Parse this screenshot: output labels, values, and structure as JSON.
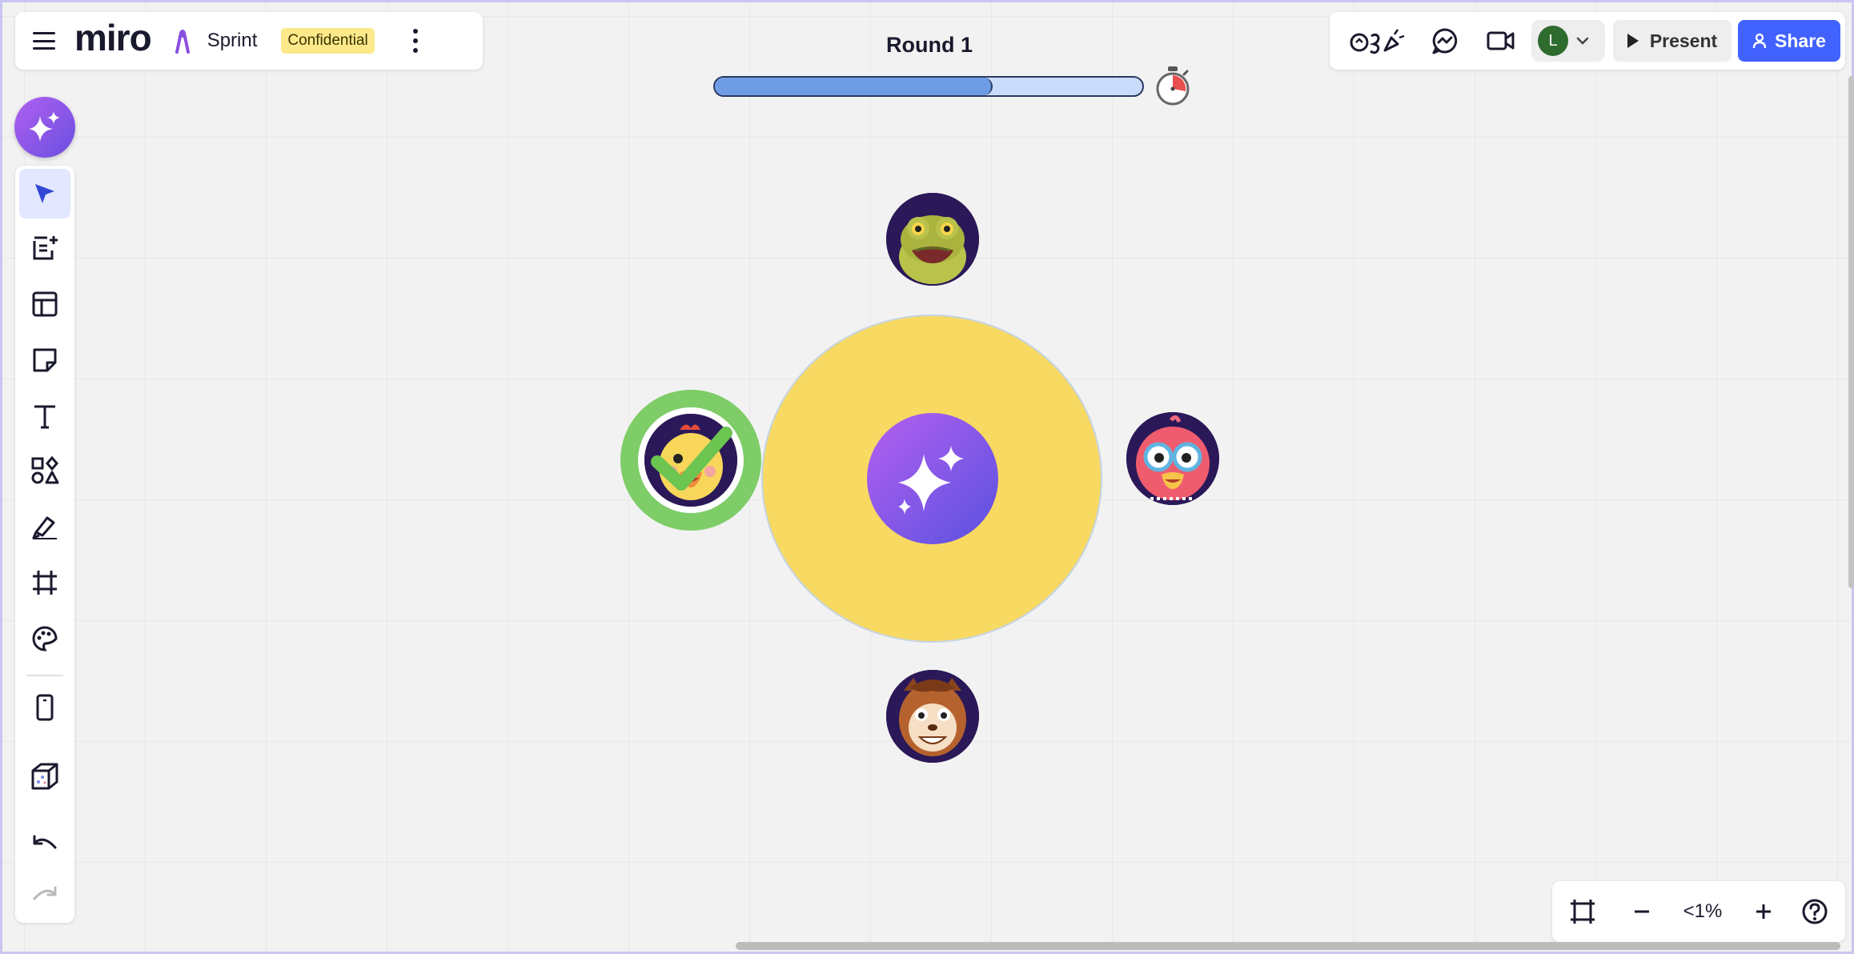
{
  "board": {
    "logo": "miro",
    "name": "Sprint",
    "badge": "Confidential"
  },
  "round": {
    "title": "Round 1",
    "progress_fraction": 0.65
  },
  "toolbar_right": {
    "icons": [
      "reactions-icon",
      "comments-icon",
      "video-call-icon"
    ],
    "user_initial": "L",
    "present_label": "Present",
    "share_label": "Share"
  },
  "left_toolbar": {
    "tools": [
      "select-tool",
      "templates-tool",
      "frames-tool",
      "sticky-note-tool",
      "text-tool",
      "shapes-tool",
      "pen-tool",
      "frame-tool",
      "sticker-tool",
      "mobile-frame-tool",
      "3d-tool",
      "undo",
      "redo"
    ]
  },
  "participants": [
    {
      "name": "frog-avatar",
      "ready": false
    },
    {
      "name": "duck-avatar",
      "ready": true
    },
    {
      "name": "bird-avatar",
      "ready": false
    },
    {
      "name": "monkey-avatar",
      "ready": false
    }
  ],
  "zoom": {
    "level": "<1%"
  },
  "colors": {
    "accent": "#4262ff",
    "table_fill": "#f8d962",
    "ready_ring": "#7ecd68",
    "ai_gradient_start": "#b45ff0",
    "ai_gradient_end": "#5a52e0",
    "badge_bg": "#fbe98a"
  }
}
